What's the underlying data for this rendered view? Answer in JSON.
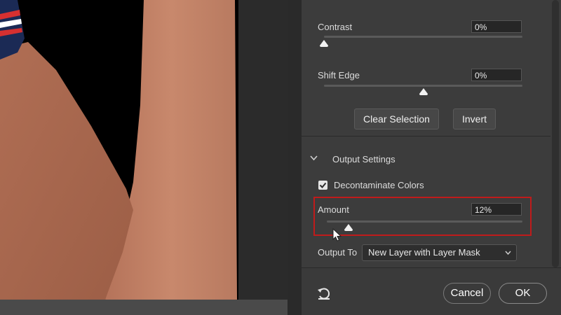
{
  "refine": {
    "contrast": {
      "label": "Contrast",
      "value": "0%",
      "level": 0
    },
    "shift_edge": {
      "label": "Shift Edge",
      "value": "0%",
      "level": 0.5
    },
    "clear_selection_label": "Clear Selection",
    "invert_label": "Invert"
  },
  "output": {
    "section_title": "Output Settings",
    "decontaminate_label": "Decontaminate Colors",
    "decontaminate_checked": true,
    "amount": {
      "label": "Amount",
      "value": "12%",
      "level": 0.12
    },
    "output_to_label": "Output To",
    "output_to_value": "New Layer with Layer Mask"
  },
  "footer": {
    "cancel_label": "Cancel",
    "ok_label": "OK"
  },
  "colors": {
    "highlight": "#c01b1b",
    "panel_bg": "#3c3c3c"
  },
  "icons": {
    "collapse": "chevron-down-icon",
    "reset": "reset-icon",
    "cursor": "cursor-icon",
    "check": "checkmark-icon"
  }
}
